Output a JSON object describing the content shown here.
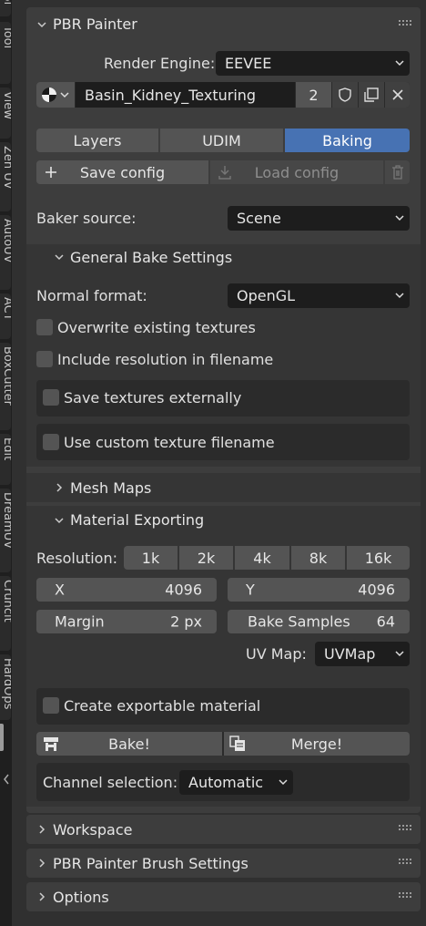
{
  "side_tabs": [
    "Tool",
    "View",
    "Zen UV",
    "AutoUV",
    "ACT",
    "BoxCutter",
    "Edit",
    "DreamUV",
    "Cruncit",
    "HardOps"
  ],
  "panel": {
    "title": "PBR Painter",
    "render_engine_label": "Render Engine:",
    "render_engine_value": "EEVEE",
    "material_name": "Basin_Kidney_Texturing",
    "material_users": "2",
    "mode_tabs": [
      "Layers",
      "UDIM",
      "Baking"
    ],
    "active_mode": "Baking",
    "save_config": "Save config",
    "load_config": "Load config",
    "baker_source_label": "Baker source:",
    "baker_source_value": "Scene"
  },
  "general": {
    "title": "General Bake Settings",
    "normal_format_label": "Normal format:",
    "normal_format_value": "OpenGL",
    "overwrite": "Overwrite existing textures",
    "include_res": "Include resolution in filename",
    "save_external": "Save textures externally",
    "custom_filename": "Use custom texture filename"
  },
  "mesh_maps": {
    "title": "Mesh Maps"
  },
  "material_exporting": {
    "title": "Material Exporting",
    "resolution_label": "Resolution:",
    "resolution_presets": [
      "1k",
      "2k",
      "4k",
      "8k",
      "16k"
    ],
    "x_label": "X",
    "x_value": "4096",
    "y_label": "Y",
    "y_value": "4096",
    "margin_label": "Margin",
    "margin_value": "2 px",
    "samples_label": "Bake Samples",
    "samples_value": "64",
    "uv_map_label": "UV Map:",
    "uv_map_value": "UVMap",
    "create_material": "Create exportable material",
    "bake_button": "Bake!",
    "merge_button": "Merge!",
    "channel_label": "Channel selection:",
    "channel_value": "Automatic"
  },
  "collapsed_panels": [
    "Workspace",
    "PBR Painter Brush Settings",
    "Options"
  ],
  "colors": {
    "active_tab": "#4772b3",
    "panel_bg": "#3d3d3d",
    "field_bg": "#1d1d1d",
    "button_bg": "#545454"
  }
}
